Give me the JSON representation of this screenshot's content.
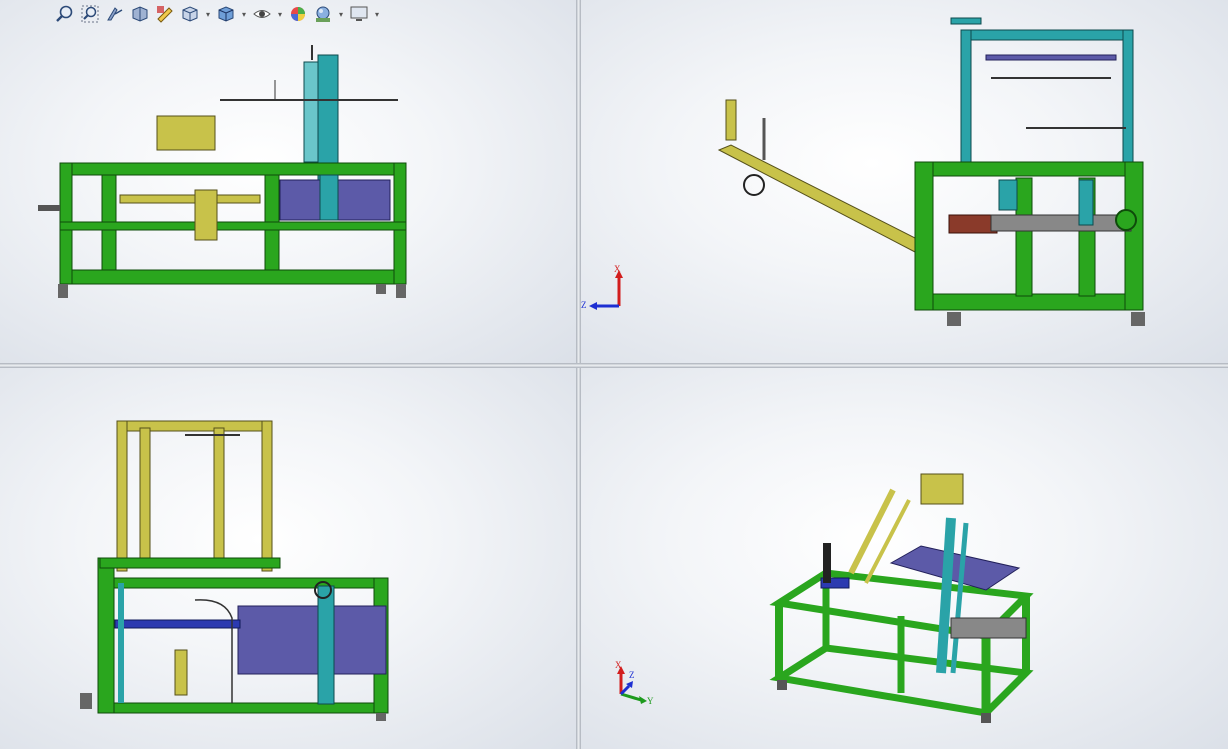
{
  "app": "SolidWorks",
  "toolbar": {
    "icons": [
      "zoom-to-fit-icon",
      "zoom-to-area-icon",
      "previous-view-icon",
      "section-view-icon",
      "view-orientation-icon",
      "display-style-icon",
      "hide-show-items-icon",
      "edit-appearance-icon",
      "apply-scene-icon",
      "view-settings-icon"
    ],
    "dropdown_glyph": "▾"
  },
  "viewports": [
    {
      "name": "front",
      "triad": null
    },
    {
      "name": "right",
      "triad": {
        "x": "X",
        "y": null,
        "z": "Z"
      }
    },
    {
      "name": "top",
      "triad": null
    },
    {
      "name": "isometric",
      "triad": {
        "x": "X",
        "y": "Y",
        "z": "Z"
      }
    }
  ],
  "colors": {
    "frame_green": "#2aa61e",
    "frame_dark": "#0e4b0a",
    "teal": "#2aa3a8",
    "purple": "#5c5aa8",
    "olive": "#c8c24a",
    "axis_x": "#d21d1d",
    "axis_y": "#1e9a1e",
    "axis_z": "#1d2fd2"
  }
}
